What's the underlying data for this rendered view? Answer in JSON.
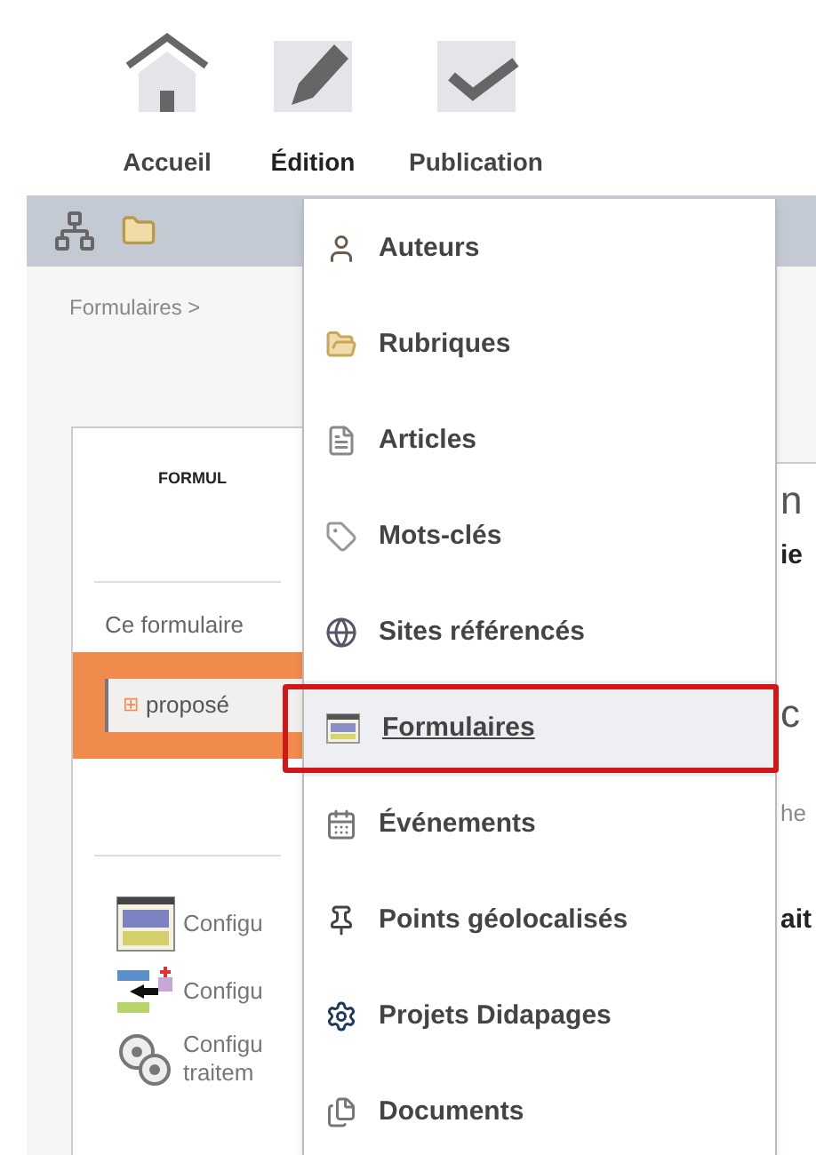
{
  "nav": [
    {
      "label": "Accueil",
      "kind": "home",
      "selected": false
    },
    {
      "label": "Édition",
      "kind": "edit",
      "selected": true
    },
    {
      "label": "Publication",
      "kind": "publish",
      "selected": false
    }
  ],
  "breadcrumb": "Formulaires >",
  "card": {
    "heading": "FORMUL",
    "intro": "Ce formulaire",
    "status": {
      "symbol": "⊞",
      "value": "proposé"
    },
    "links": [
      {
        "kind": "layout",
        "label": "Configu"
      },
      {
        "kind": "fields",
        "label": "Configu"
      },
      {
        "kind": "process",
        "label": "Configu",
        "label_2": "traitem"
      }
    ]
  },
  "right_fragments": [
    {
      "text": "n",
      "kind": "large"
    },
    {
      "text": "ie",
      "kind": "bold"
    },
    {
      "text": "c",
      "kind": "large"
    },
    {
      "text": "he",
      "kind": "plain"
    },
    {
      "text": "ait",
      "kind": "bold"
    }
  ],
  "menu": [
    {
      "label": "Auteurs",
      "kind": "person",
      "selected": false
    },
    {
      "label": "Rubriques",
      "kind": "folder",
      "selected": false
    },
    {
      "label": "Articles",
      "kind": "article",
      "selected": false
    },
    {
      "label": "Mots-clés",
      "kind": "tag",
      "selected": false
    },
    {
      "label": "Sites référencés",
      "kind": "site",
      "selected": false
    },
    {
      "label": "Formulaires",
      "kind": "form",
      "selected": true
    },
    {
      "label": "Événements",
      "kind": "calendar",
      "selected": false
    },
    {
      "label": "Points géolocalisés",
      "kind": "pin",
      "selected": false
    },
    {
      "label": "Projets Didapages",
      "kind": "project",
      "selected": false
    },
    {
      "label": "Documents",
      "kind": "documents",
      "selected": false
    }
  ]
}
